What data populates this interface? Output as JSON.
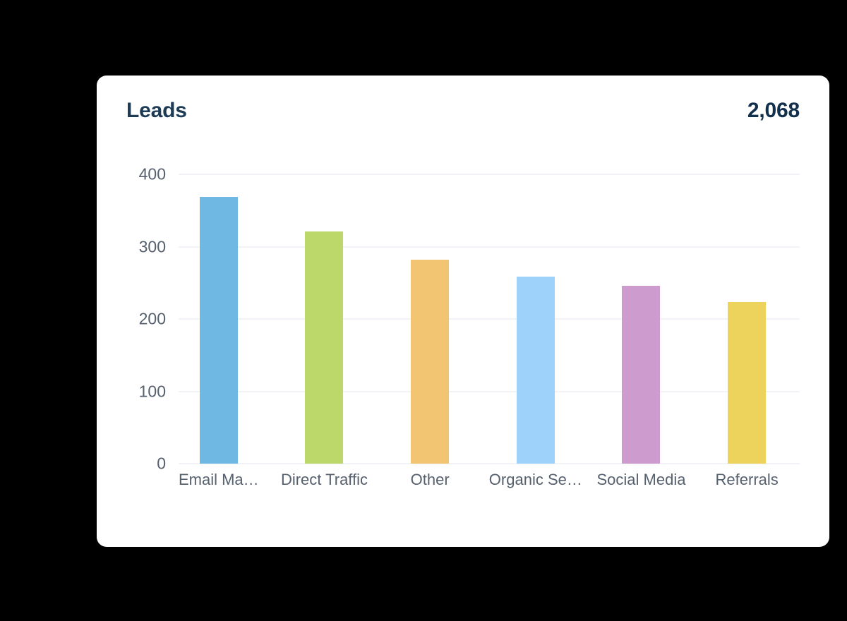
{
  "card": {
    "title": "Leads",
    "total": "2,068"
  },
  "colors": {
    "card_background": "#ffffff",
    "page_background": "#000000",
    "title": "#1d3b55",
    "total": "#12304b",
    "tick_label": "#56606e",
    "gridline": "#f1f3f6"
  },
  "chart_data": {
    "type": "bar",
    "title": "Leads",
    "xlabel": "",
    "ylabel": "",
    "ylim": [
      0,
      400
    ],
    "yticks": [
      0,
      100,
      200,
      300,
      400
    ],
    "ytick_labels": [
      "0",
      "100",
      "200",
      "300",
      "400"
    ],
    "grid": true,
    "legend": "none",
    "total_label": "2,068",
    "categories": [
      "Email Ma…",
      "Direct Traffic",
      "Other",
      "Organic Se…",
      "Social Media",
      "Referrals"
    ],
    "values": [
      369,
      321,
      282,
      259,
      246,
      223
    ],
    "bar_colors": [
      "#6fb8e3",
      "#bdd86a",
      "#f2c572",
      "#9ed2fb",
      "#ce9bce",
      "#edd25c"
    ]
  }
}
